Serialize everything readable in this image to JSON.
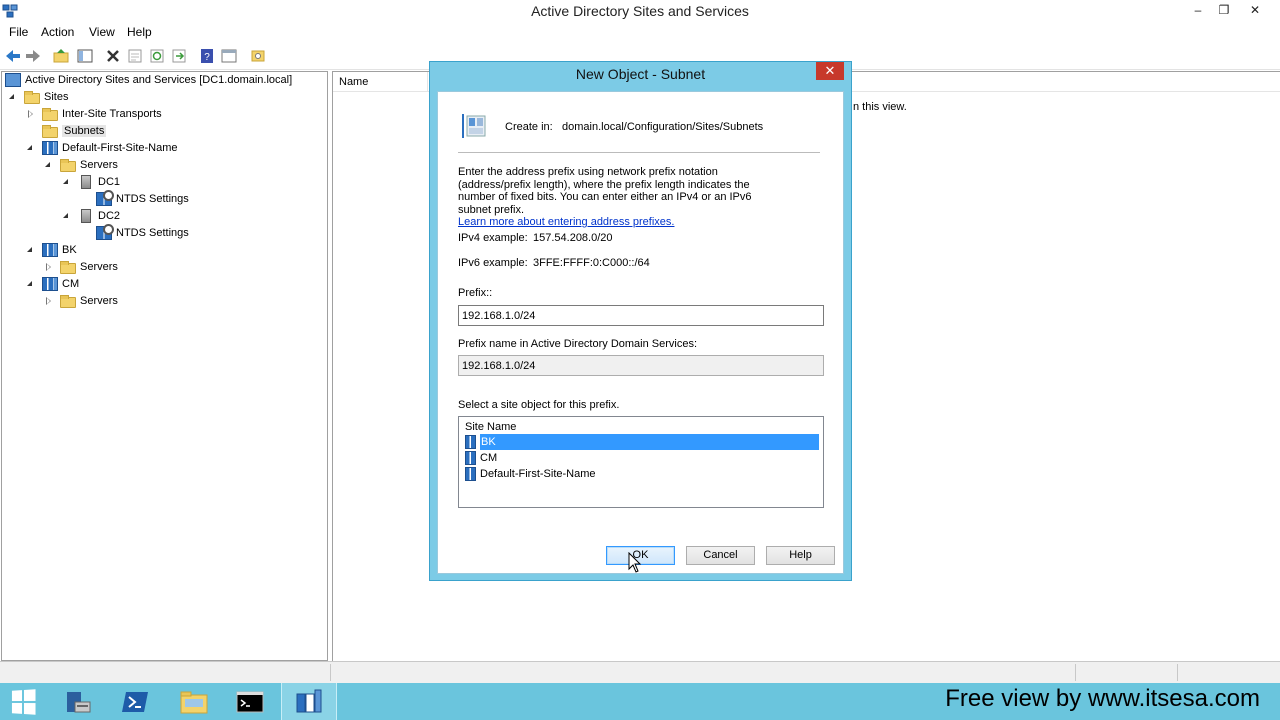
{
  "window": {
    "title": "Active Directory Sites and Services"
  },
  "window_controls": {
    "minimize": "–",
    "maximize": "❐",
    "close": "✕"
  },
  "menu": [
    "File",
    "Action",
    "View",
    "Help"
  ],
  "tree": {
    "root": "Active Directory Sites and Services [DC1.domain.local]",
    "sites": "Sites",
    "inter_site": "Inter-Site Transports",
    "subnets": "Subnets",
    "default_site": "Default-First-Site-Name",
    "servers1": "Servers",
    "dc1": "DC1",
    "ntds1": "NTDS Settings",
    "dc2": "DC2",
    "ntds2": "NTDS Settings",
    "bk": "BK",
    "servers2": "Servers",
    "cm": "CM",
    "servers3": "Servers"
  },
  "list_pane": {
    "column_name": "Name",
    "empty_message": "n this view."
  },
  "dialog": {
    "title": "New Object - Subnet",
    "close_label": "✕",
    "create_in_label": "Create in:",
    "create_in_value": "domain.local/Configuration/Sites/Subnets",
    "description": "Enter the address prefix using network prefix notation (address/prefix length), where the prefix length indicates the number of fixed bits. You can enter either an IPv4 or an IPv6 subnet prefix.",
    "learn_more": "Learn more about entering address prefixes.",
    "ipv4_label": "IPv4 example:",
    "ipv4_value": "157.54.208.0/20",
    "ipv6_label": "IPv6 example:",
    "ipv6_value": "3FFE:FFFF:0:C000::/64",
    "prefix_label": "Prefix::",
    "prefix_value": "192.168.1.0/24",
    "prefix_name_label": "Prefix name in Active Directory Domain Services:",
    "prefix_name_value": "192.168.1.0/24",
    "site_select_label": "Select a site object for this prefix.",
    "site_list_header": "Site Name",
    "sites": [
      "BK",
      "CM",
      "Default-First-Site-Name"
    ],
    "selected_site": "BK",
    "ok_label": "OK",
    "cancel_label": "Cancel",
    "help_label": "Help"
  },
  "watermark": "Free view by www.itsesa.com",
  "colors": {
    "taskbar": "#6ac5dd",
    "dialog_frame": "#7ccbe6",
    "selection": "#3399ff",
    "close_button": "#c7392b",
    "link": "#0033cc"
  }
}
